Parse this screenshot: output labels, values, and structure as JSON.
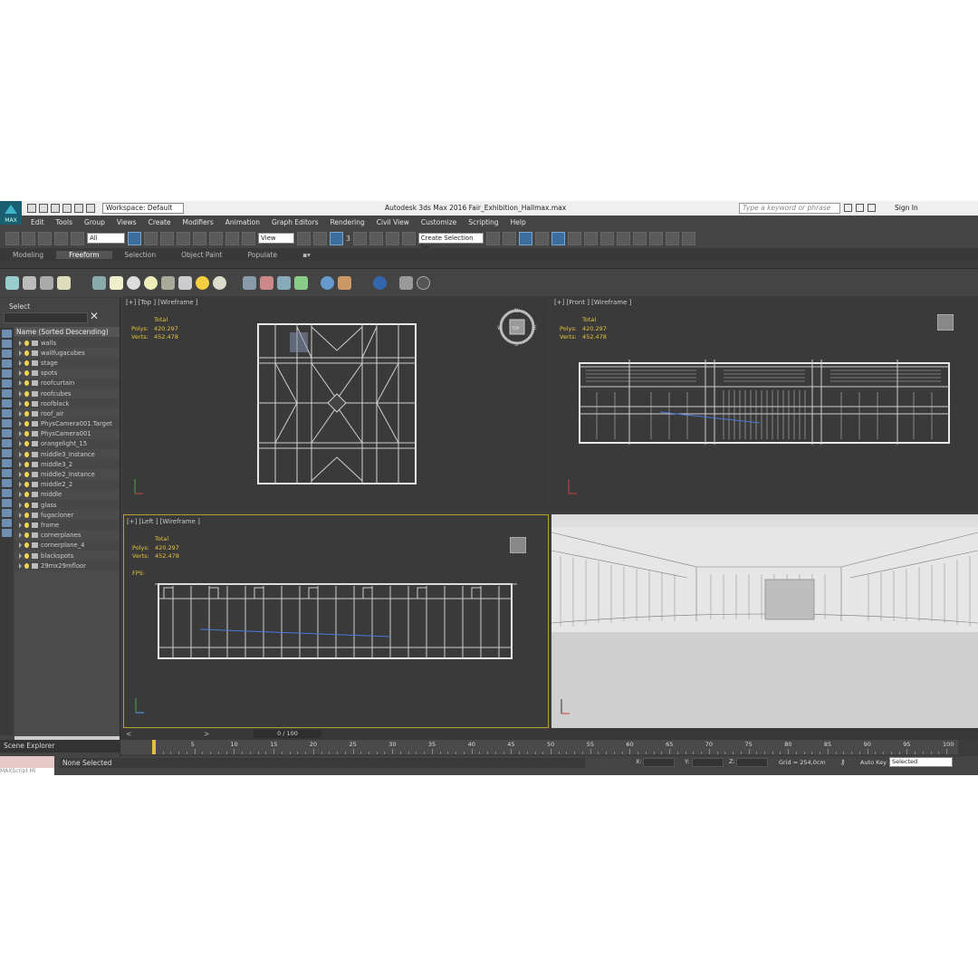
{
  "window": {
    "title": "Autodesk 3ds Max 2016     Fair_Exhibition_Hallmax.max",
    "workspace": "Workspace: Default",
    "logo": "MAX",
    "search_placeholder": "Type a keyword or phrase",
    "sign_in": "Sign In"
  },
  "menu": [
    "Edit",
    "Tools",
    "Group",
    "Views",
    "Create",
    "Modifiers",
    "Animation",
    "Graph Editors",
    "Rendering",
    "Civil View",
    "Customize",
    "Scripting",
    "Help"
  ],
  "toolbar": {
    "filter": "All",
    "ref_coord": "View",
    "selection_set": "Create Selection Se",
    "snap": "3"
  },
  "ribbon_tabs": [
    {
      "label": "Modeling",
      "active": false
    },
    {
      "label": "Freeform",
      "active": true
    },
    {
      "label": "Selection",
      "active": false
    },
    {
      "label": "Object Paint",
      "active": false
    },
    {
      "label": "Populate",
      "active": false
    }
  ],
  "scene_explorer": {
    "header": "Select",
    "column": "Name (Sorted Descending)",
    "footer": "Scene Explorer",
    "items": [
      {
        "name": "walls",
        "type": "obj"
      },
      {
        "name": "wallfugacubes",
        "type": "obj"
      },
      {
        "name": "stage",
        "type": "obj"
      },
      {
        "name": "spots",
        "type": "obj"
      },
      {
        "name": "roofcurtain",
        "type": "obj"
      },
      {
        "name": "roofcubes",
        "type": "obj"
      },
      {
        "name": "roofblack",
        "type": "obj"
      },
      {
        "name": "roof_air",
        "type": "obj"
      },
      {
        "name": "PhysCamera001.Target",
        "type": "cam"
      },
      {
        "name": "PhysCamera001",
        "type": "cam"
      },
      {
        "name": "orangelight_15",
        "type": "obj"
      },
      {
        "name": "middle3_Instance",
        "type": "obj"
      },
      {
        "name": "middle3_2",
        "type": "obj"
      },
      {
        "name": "middle2_Instance",
        "type": "obj"
      },
      {
        "name": "middle2_2",
        "type": "obj"
      },
      {
        "name": "middle",
        "type": "obj"
      },
      {
        "name": "glass",
        "type": "obj"
      },
      {
        "name": "fugacloner",
        "type": "obj"
      },
      {
        "name": "frame",
        "type": "obj"
      },
      {
        "name": "cornerplanes",
        "type": "obj"
      },
      {
        "name": "cornerplane_4",
        "type": "obj"
      },
      {
        "name": "blackspots",
        "type": "obj"
      },
      {
        "name": "29mx29mfloor",
        "type": "obj"
      }
    ]
  },
  "viewports": {
    "top": {
      "label": "[+] [Top ] [Wireframe ]",
      "stats_header": "Total",
      "polys_label": "Polys:",
      "polys": "420.297",
      "verts_label": "Verts:",
      "verts": "452.478"
    },
    "front": {
      "label": "[+] [Front ] [Wireframe ]",
      "stats_header": "Total",
      "polys_label": "Polys:",
      "polys": "420.297",
      "verts_label": "Verts:",
      "verts": "452.478"
    },
    "left": {
      "label": "[+] [Left ] [Wireframe ]",
      "stats_header": "Total",
      "polys_label": "Polys:",
      "polys": "420.297",
      "verts_label": "Verts:",
      "verts": "452.478",
      "fps_label": "FPS:"
    }
  },
  "viewcube": {
    "n": "N",
    "s": "S",
    "e": "E",
    "w": "W",
    "face": "TOP"
  },
  "timeline": {
    "frame": "0 / 100",
    "ticks": [
      "5",
      "10",
      "15",
      "20",
      "25",
      "30",
      "35",
      "40",
      "45",
      "50",
      "55",
      "60",
      "65",
      "70",
      "75",
      "80",
      "85",
      "90",
      "95",
      "100"
    ]
  },
  "status": {
    "selection": "None Selected",
    "x_label": "X:",
    "y_label": "Y:",
    "z_label": "Z:",
    "grid": "Grid = 254,0cm",
    "auto_key": "Auto Key",
    "key_mode": "Selected",
    "maxscript": "MAXScript Mi"
  },
  "colors": {
    "stat": "#e6c53b",
    "accent": "#3b6d9e",
    "viewport": "#3a3a3a",
    "active_border": "#b8a030"
  }
}
